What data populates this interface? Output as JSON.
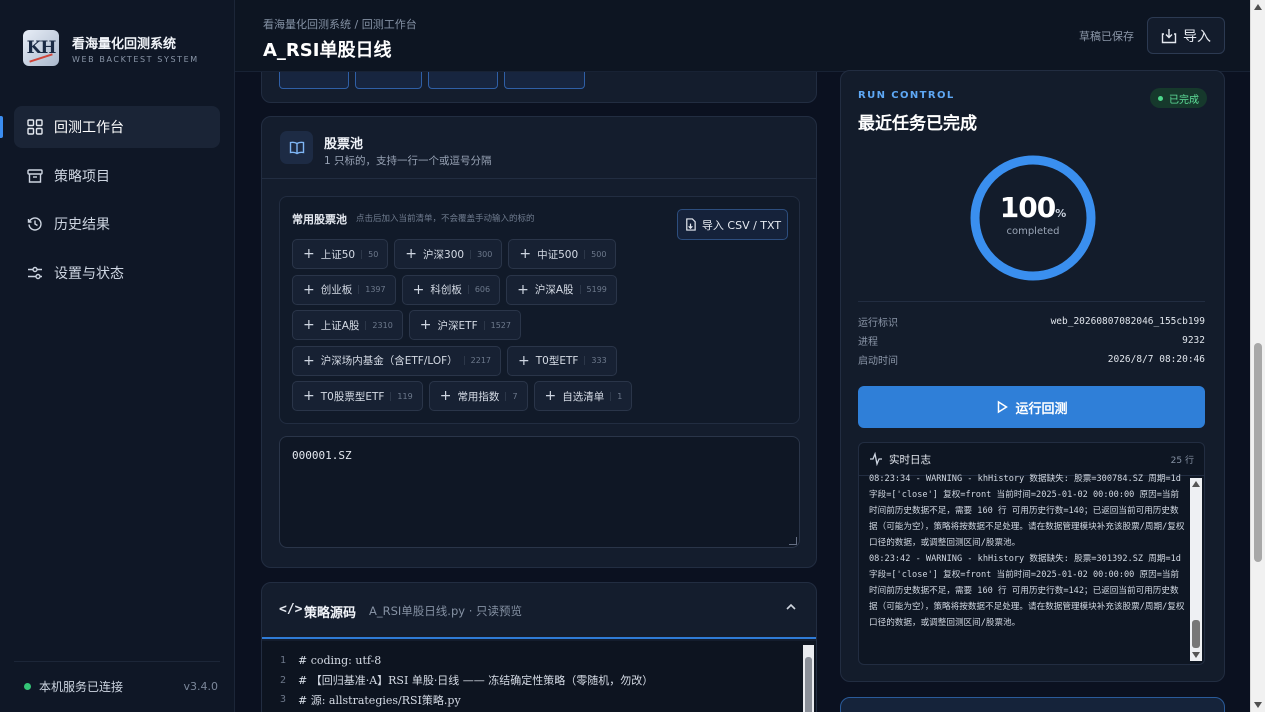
{
  "brand": {
    "logo": "KH",
    "title": "看海量化回测系统",
    "subtitle": "WEB BACKTEST SYSTEM"
  },
  "sidebar": {
    "items": [
      {
        "label": "回测工作台",
        "icon": "grid-icon",
        "active": true
      },
      {
        "label": "策略项目",
        "icon": "archive-icon",
        "active": false
      },
      {
        "label": "历史结果",
        "icon": "history-icon",
        "active": false
      },
      {
        "label": "设置与状态",
        "icon": "sliders-icon",
        "active": false
      }
    ],
    "footer": {
      "status": "本机服务已连接",
      "version": "v3.4.0"
    }
  },
  "header": {
    "breadcrumb": "看海量化回测系统 / 回测工作台",
    "title": "A_RSI单股日线",
    "saved_text": "草稿已保存",
    "import_label": "导入"
  },
  "pool": {
    "title": "股票池",
    "subtitle": "1 只标的，支持一行一个或逗号分隔",
    "presets_title": "常用股票池",
    "presets_hint": "点击后加入当前清单，不会覆盖手动输入的标的",
    "csv_label": "导入 CSV / TXT",
    "chips": [
      [
        {
          "label": "上证50",
          "count": "50"
        },
        {
          "label": "沪深300",
          "count": "300"
        },
        {
          "label": "中证500",
          "count": "500"
        }
      ],
      [
        {
          "label": "创业板",
          "count": "1397"
        },
        {
          "label": "科创板",
          "count": "606"
        },
        {
          "label": "沪深A股",
          "count": "5199"
        }
      ],
      [
        {
          "label": "上证A股",
          "count": "2310"
        },
        {
          "label": "沪深ETF",
          "count": "1527"
        }
      ],
      [
        {
          "label": "沪深场内基金（含ETF/LOF）",
          "count": "2217"
        },
        {
          "label": "T0型ETF",
          "count": "333"
        }
      ],
      [
        {
          "label": "T0股票型ETF",
          "count": "119"
        },
        {
          "label": "常用指数",
          "count": "7"
        },
        {
          "label": "自选清单",
          "count": "1"
        }
      ]
    ],
    "codes": "000001.SZ"
  },
  "source": {
    "title": "策略源码",
    "subtitle": "A_RSI单股日线.py · 只读预览",
    "lines": [
      {
        "n": "1",
        "text": "# coding: utf-8"
      },
      {
        "n": "2",
        "text": "# 【回归基准·A】RSI 单股·日线 —— 冻结确定性策略（零随机，勿改）"
      },
      {
        "n": "3",
        "text": "# 源: allstrategies/RSI策略.py"
      }
    ]
  },
  "run": {
    "kicker": "RUN CONTROL",
    "title": "最近任务已完成",
    "badge": "已完成",
    "progress_value": "100",
    "progress_unit": "%",
    "progress_label": "completed",
    "progress_fraction": 1.0,
    "meta": [
      {
        "k": "运行标识",
        "v": "web_20260807082046_155cb199"
      },
      {
        "k": "进程",
        "v": "9232"
      },
      {
        "k": "启动时间",
        "v": "2026/8/7 08:20:46"
      }
    ],
    "run_label": "运行回测",
    "log_title": "实时日志",
    "log_count": "25 行",
    "log_text": "08:23:34 - WARNING - khHistory 数据缺失: 股票=300784.SZ 周期=1d 字段=['close'] 复权=front 当前时间=2025-01-02 00:00:00 原因=当前时间前历史数据不足，需要 160 行 可用历史行数=140；已返回当前可用历史数据（可能为空），策略将按数据不足处理。请在数据管理模块补充该股票/周期/复权口径的数据，或调整回测区间/股票池。\n08:23:42 - WARNING - khHistory 数据缺失: 股票=301392.SZ 周期=1d 字段=['close'] 复权=front 当前时间=2025-01-02 00:00:00 原因=当前时间前历史数据不足，需要 160 行 可用历史行数=142；已返回当前可用历史数据（可能为空），策略将按数据不足处理。请在数据管理模块补充该股票/周期/复权口径的数据，或调整回测区间/股票池。"
  },
  "colors": {
    "accent": "#2f7fd8",
    "success": "#4cd88b",
    "background": "#0b1120"
  }
}
